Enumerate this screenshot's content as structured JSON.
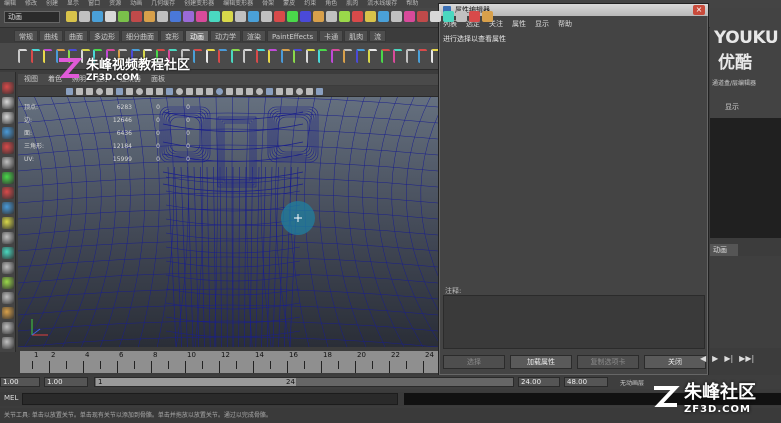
{
  "menubar": {
    "items": [
      "编辑",
      "修改",
      "创建",
      "显示",
      "窗口",
      "资源",
      "动画",
      "几何缓存",
      "创建变形器",
      "编辑变形器",
      "骨架",
      "蒙皮",
      "约束",
      "角色",
      "肌肉",
      "流水线缓存",
      "帮助"
    ]
  },
  "statusline": {
    "mode": "动画"
  },
  "shelf": {
    "tabs": [
      "常规",
      "曲线",
      "曲面",
      "多边形",
      "细分曲面",
      "变形",
      "动画",
      "动力学",
      "渲染",
      "PaintEffects",
      "卡通",
      "肌肉",
      "流"
    ],
    "active_index": 6
  },
  "panel": {
    "menu": [
      "视图",
      "着色",
      "照明",
      "显示",
      "渲染器",
      "面板"
    ]
  },
  "hud": {
    "rows": [
      {
        "label": "顶点:",
        "a": "6283",
        "b": "0",
        "c": "0"
      },
      {
        "label": "边:",
        "a": "12646",
        "b": "0",
        "c": "0"
      },
      {
        "label": "面:",
        "a": "6436",
        "b": "0",
        "c": "0"
      },
      {
        "label": "三角形:",
        "a": "12184",
        "b": "0",
        "c": "0"
      },
      {
        "label": "UV:",
        "a": "15999",
        "b": "0",
        "c": "0"
      }
    ]
  },
  "attribute_editor": {
    "title": "属性编辑器",
    "close_glyph": "×",
    "menu": [
      "列表",
      "选定",
      "关注",
      "属性",
      "显示",
      "帮助"
    ],
    "hint": "进行选择以查看属性",
    "notes_label": "注释:",
    "buttons": [
      {
        "label": "选择",
        "enabled": false
      },
      {
        "label": "加载属性",
        "enabled": true
      },
      {
        "label": "复制选项卡",
        "enabled": false
      },
      {
        "label": "关闭",
        "enabled": true
      }
    ]
  },
  "right_panel": {
    "logo_en": "YOUKU",
    "logo_cn": "优酷",
    "label_top": "通道盒/层编辑器",
    "label_display": "显示",
    "anim_tab": "动画"
  },
  "timeline": {
    "ticks": [
      "1",
      "2",
      "4",
      "6",
      "8",
      "10",
      "12",
      "14",
      "16",
      "18",
      "20",
      "22",
      "24"
    ]
  },
  "range": {
    "start": "1.00",
    "playback_start": "1.00",
    "thumb_start": "1",
    "thumb_end": "24",
    "playback_end": "24.00",
    "end": "48.00",
    "autokey": "无动画层"
  },
  "playback_controls": [
    "◀",
    "▶",
    "▶|",
    "▶▶|"
  ],
  "cmdline": {
    "label": "MEL"
  },
  "helpline": {
    "text": "关节工具: 单击以放置关节。单击现有关节以添加到骨骼。单击并拖放以放置关节。通过以完成骨骼。"
  },
  "watermarks": {
    "top_cn": "朱峰视频教程社区",
    "top_en": "ZF3D.COM",
    "bottom_cn": "朱峰社区",
    "bottom_en": "ZF3D.COM"
  },
  "colors": {
    "manipulator": "#1f7fa0",
    "wire": "#1a1f8c"
  }
}
